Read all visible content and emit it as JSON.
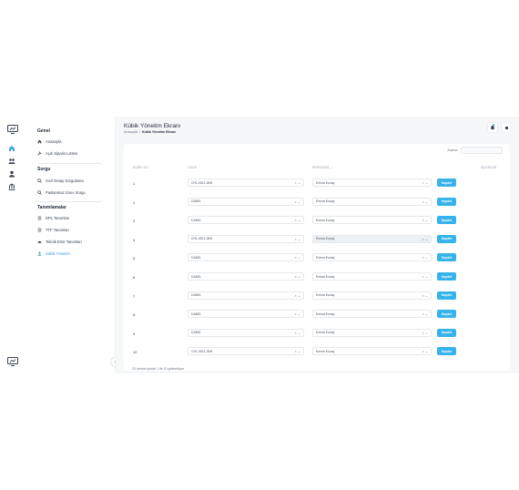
{
  "rail": {
    "icons": [
      "logo-icon",
      "home-icon",
      "users-group-icon",
      "user-icon",
      "building-icon"
    ]
  },
  "sidebar": {
    "sections": [
      {
        "title": "Genel",
        "items": [
          {
            "label": "Anasayfa",
            "icon": "home-icon"
          },
          {
            "label": "Açık Siparis Listesi",
            "icon": "tools-icon"
          }
        ]
      },
      {
        "title": "Sorgu",
        "items": [
          {
            "label": "Sıcıl Detay Sorgulama",
            "icon": "search-icon"
          },
          {
            "label": "Paslanmaz Sınıv Sorgu",
            "icon": "search-icon"
          }
        ]
      },
      {
        "title": "Tanımlamalar",
        "items": [
          {
            "label": "DPL Tanımları",
            "icon": "list-icon"
          },
          {
            "label": "TTF Tanımları",
            "icon": "list-icon"
          },
          {
            "label": "Teknik Emir Tanımları",
            "icon": "gauge-icon"
          },
          {
            "label": "Kübik Yönetim",
            "icon": "user-icon",
            "active": true
          }
        ]
      }
    ],
    "collapse_glyph": "‹"
  },
  "header": {
    "title": "Kübik Yönetim Ekranı",
    "breadcrumb": [
      "Anasayfa",
      "/",
      "Kübik Yönetim Ekranı"
    ]
  },
  "search": {
    "label": "Arama:",
    "value": ""
  },
  "table": {
    "columns": [
      "KÜBİK NO",
      "CODE",
      "PERSONEL",
      "İŞLEMLER"
    ],
    "sort_glyph": "⌄",
    "clear_glyph": "×",
    "chevron_glyph": "⌄",
    "rows": [
      {
        "no": "1",
        "code": "CH1-0521-3BH",
        "staff": "Emma Kocaş",
        "action": "Kaydet"
      },
      {
        "no": "2",
        "code": "DAB01",
        "staff": "Emma Kocaş",
        "action": "Kaydet"
      },
      {
        "no": "3",
        "code": "DAB01",
        "staff": "Emma Kocaş",
        "action": "Kaydet"
      },
      {
        "no": "4",
        "code": "CH1-0521-3BH",
        "staff": "Emma Kocaş",
        "action": "Kaydet",
        "highlight": true
      },
      {
        "no": "5",
        "code": "DAB01",
        "staff": "Emma Kocaş",
        "action": "Kaydet"
      },
      {
        "no": "6",
        "code": "DAB01",
        "staff": "Emma Kocaş",
        "action": "Kaydet"
      },
      {
        "no": "7",
        "code": "DAB01",
        "staff": "Emma Kocaş",
        "action": "Kaydet"
      },
      {
        "no": "8",
        "code": "DAB01",
        "staff": "Emma Kocaş",
        "action": "Kaydet"
      },
      {
        "no": "9",
        "code": "DAB01",
        "staff": "Emma Kocaş",
        "action": "Kaydet"
      },
      {
        "no": "10",
        "code": "CH1-0521-3BH",
        "staff": "Emma Kocaş",
        "action": "Kaydet"
      }
    ],
    "footer": "20 verinin içinde 1 ile 10 gösteriliyor"
  },
  "colors": {
    "accent": "#35b3ea",
    "active_nav": "#3b9ee0",
    "page_bg": "#f6f7f9"
  }
}
